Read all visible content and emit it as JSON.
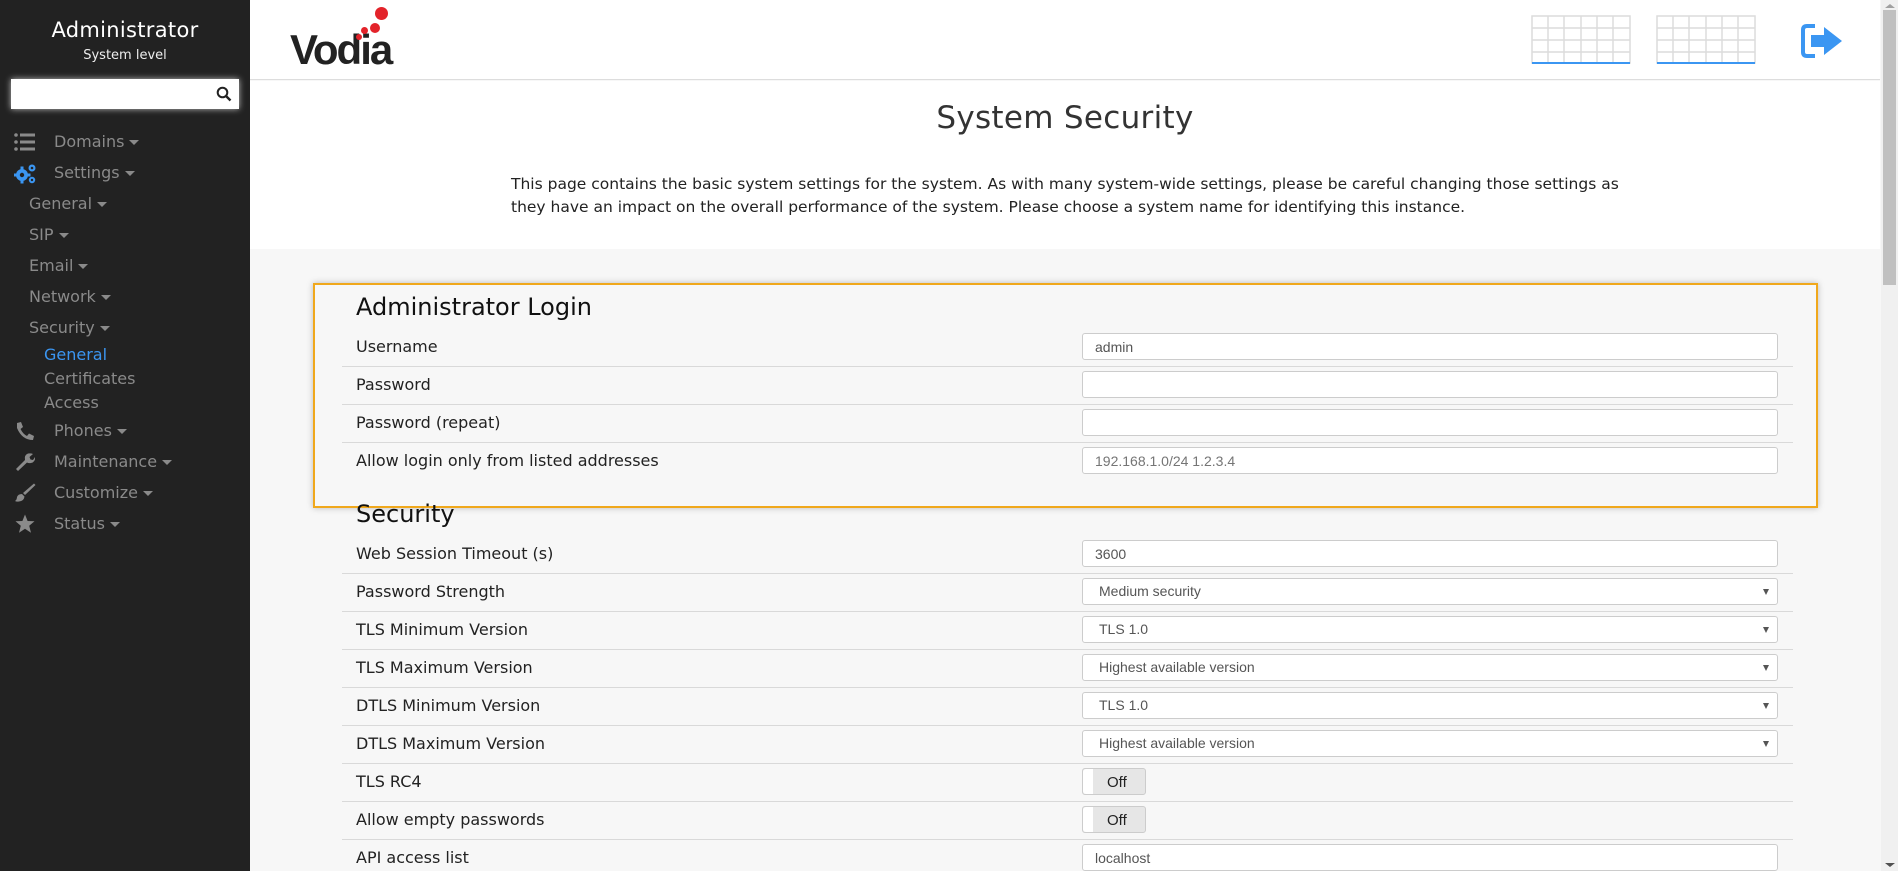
{
  "sidebar": {
    "title": "Administrator",
    "subtitle": "System level",
    "search": {
      "value": "",
      "placeholder": ""
    },
    "items": [
      {
        "label": "Domains",
        "icon": "list-icon"
      },
      {
        "label": "Settings",
        "icon": "gears-icon",
        "active": true
      },
      {
        "label": "General"
      },
      {
        "label": "SIP"
      },
      {
        "label": "Email"
      },
      {
        "label": "Network"
      },
      {
        "label": "Security"
      },
      {
        "label": "General",
        "active": true
      },
      {
        "label": "Certificates"
      },
      {
        "label": "Access"
      },
      {
        "label": "Phones",
        "icon": "phone-icon"
      },
      {
        "label": "Maintenance",
        "icon": "wrench-icon"
      },
      {
        "label": "Customize",
        "icon": "brush-icon"
      },
      {
        "label": "Status",
        "icon": "star-icon"
      }
    ]
  },
  "header": {
    "logo": "Vodia",
    "accent_color": "#3b96f2",
    "logo_dot_color": "#e3232a"
  },
  "page": {
    "title": "System Security",
    "description": "This page contains the basic system settings for the system. As with many system-wide settings, please be careful changing those settings as they have an impact on the overall performance of the system. Please choose a system name for identifying this instance."
  },
  "admin_login": {
    "title": "Administrator Login",
    "highlight_color": "#f0a81c",
    "rows": [
      {
        "label": "Username",
        "value": "admin"
      },
      {
        "label": "Password",
        "value": ""
      },
      {
        "label": "Password (repeat)",
        "value": ""
      },
      {
        "label": "Allow login only from listed addresses",
        "value": "",
        "placeholder": "192.168.1.0/24 1.2.3.4"
      }
    ]
  },
  "security": {
    "title": "Security",
    "rows": [
      {
        "label": "Web Session Timeout (s)",
        "type": "text",
        "value": "3600"
      },
      {
        "label": "Password Strength",
        "type": "select",
        "value": "Medium security"
      },
      {
        "label": "TLS Minimum Version",
        "type": "select",
        "value": "TLS 1.0"
      },
      {
        "label": "TLS Maximum Version",
        "type": "select",
        "value": "Highest available version"
      },
      {
        "label": "DTLS Minimum Version",
        "type": "select",
        "value": "TLS 1.0"
      },
      {
        "label": "DTLS Maximum Version",
        "type": "select",
        "value": "Highest available version"
      },
      {
        "label": "TLS RC4",
        "type": "toggle",
        "value": "Off"
      },
      {
        "label": "Allow empty passwords",
        "type": "toggle",
        "value": "Off"
      },
      {
        "label": "API access list",
        "type": "text",
        "value": "localhost"
      }
    ]
  }
}
